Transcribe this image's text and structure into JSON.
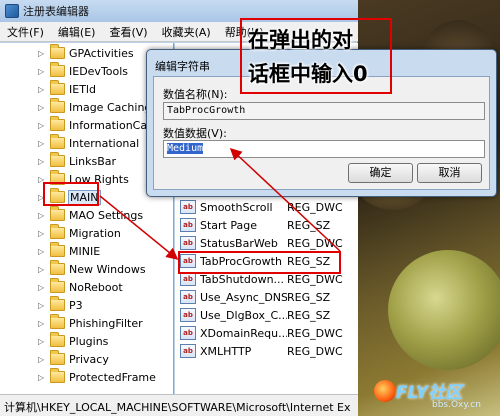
{
  "window": {
    "title": "注册表编辑器"
  },
  "menu": [
    "文件(F)",
    "编辑(E)",
    "查看(V)",
    "收藏夹(A)",
    "帮助(H)"
  ],
  "tree": {
    "items": [
      "GPActivities",
      "IEDevTools",
      "IETld",
      "Image Caching",
      "InformationCar",
      "International",
      "LinksBar",
      "Low Rights",
      "MAIN",
      "MAO Settings",
      "Migration",
      "MINIE",
      "New Windows",
      "NoReboot",
      "P3",
      "PhishingFilter",
      "Plugins",
      "Privacy",
      "ProtectedFrame"
    ],
    "selected": "MAIN"
  },
  "values": {
    "rows": [
      {
        "name": "SmoothScroll",
        "type": "REG_DWC"
      },
      {
        "name": "Start Page",
        "type": "REG_SZ"
      },
      {
        "name": "StatusBarWeb",
        "type": "REG_DWC"
      },
      {
        "name": "TabProcGrowth",
        "type": "REG_SZ"
      },
      {
        "name": "TabShutdown...",
        "type": "REG_DWC"
      },
      {
        "name": "Use_Async_DNS",
        "type": "REG_SZ"
      },
      {
        "name": "Use_DlgBox_C...",
        "type": "REG_SZ"
      },
      {
        "name": "XDomainRequ...",
        "type": "REG_DWC"
      },
      {
        "name": "XMLHTTP",
        "type": "REG_DWC"
      }
    ],
    "highlighted": "TabProcGrowth"
  },
  "statusbar": {
    "path": "计算机\\HKEY_LOCAL_MACHINE\\SOFTWARE\\Microsoft\\Internet Ex"
  },
  "dialog": {
    "title": "编辑字符串",
    "name_label": "数值名称(N):",
    "name_value": "TabProcGrowth",
    "data_label": "数值数据(V):",
    "data_value": "Medium",
    "ok_label": "确定",
    "cancel_label": "取消"
  },
  "annotation": {
    "line1": "在弹出的对",
    "line2": "话框中输入0",
    "color": "#e00000"
  },
  "watermark": {
    "brand": "FLY社区",
    "url": "bbs.Oxy.cn"
  }
}
